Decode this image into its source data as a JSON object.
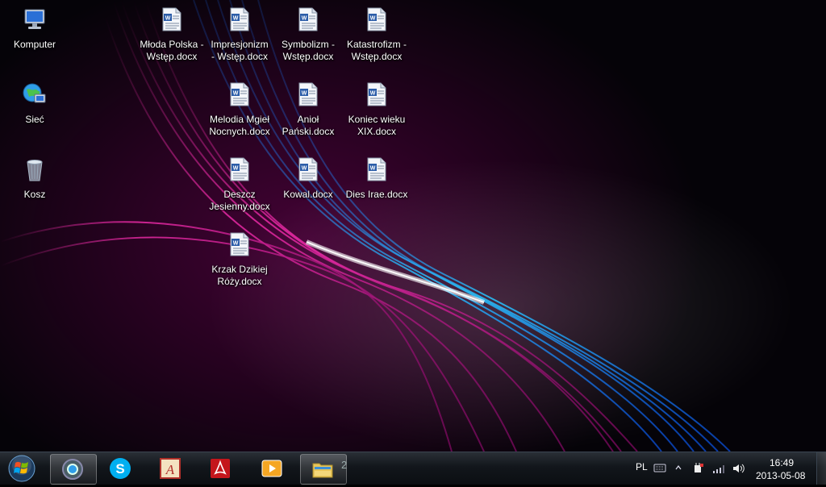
{
  "desktop": {
    "icons": [
      {
        "label": "Komputer",
        "kind": "computer-icon"
      },
      {
        "label": "Sieć",
        "kind": "network-icon"
      },
      {
        "label": "Kosz",
        "kind": "recycle-bin-icon"
      },
      {
        "label": "Młoda Polska -\nWstęp.docx",
        "kind": "docx-icon"
      },
      {
        "label": "Impresjonizm\n- Wstęp.docx",
        "kind": "docx-icon"
      },
      {
        "label": "Symbolizm -\nWstęp.docx",
        "kind": "docx-icon"
      },
      {
        "label": "Katastrofizm -\nWstęp.docx",
        "kind": "docx-icon"
      },
      {
        "label": "Melodia Mgieł\nNocnych.docx",
        "kind": "docx-icon"
      },
      {
        "label": "Anioł\nPański.docx",
        "kind": "docx-icon"
      },
      {
        "label": "Koniec wieku\nXIX.docx",
        "kind": "docx-icon"
      },
      {
        "label": "Deszcz\nJesienny.docx",
        "kind": "docx-icon"
      },
      {
        "label": "Kowal.docx",
        "kind": "docx-icon"
      },
      {
        "label": "Dies Irae.docx",
        "kind": "docx-icon"
      },
      {
        "label": "Krzak Dzikiej\nRóży.docx",
        "kind": "docx-icon"
      }
    ]
  },
  "taskbar": {
    "pinned": [
      "chrome-icon",
      "skype-icon",
      "dictionary-icon",
      "pdf-reader-icon",
      "media-player-icon",
      "explorer-folder-icon"
    ],
    "explorer_window_count": "2",
    "tray": {
      "language": "PL",
      "icons": [
        "keyboard-icon",
        "show-hidden-icons-chevron-icon",
        "power-plug-icon",
        "signal-bars-icon",
        "speaker-icon"
      ]
    },
    "clock": {
      "time": "16:49",
      "date": "2013-05-08"
    }
  },
  "colors": {
    "accent_cyan": "#29c6ff",
    "accent_magenta": "#d6148f",
    "taskbar": "#12161b"
  }
}
